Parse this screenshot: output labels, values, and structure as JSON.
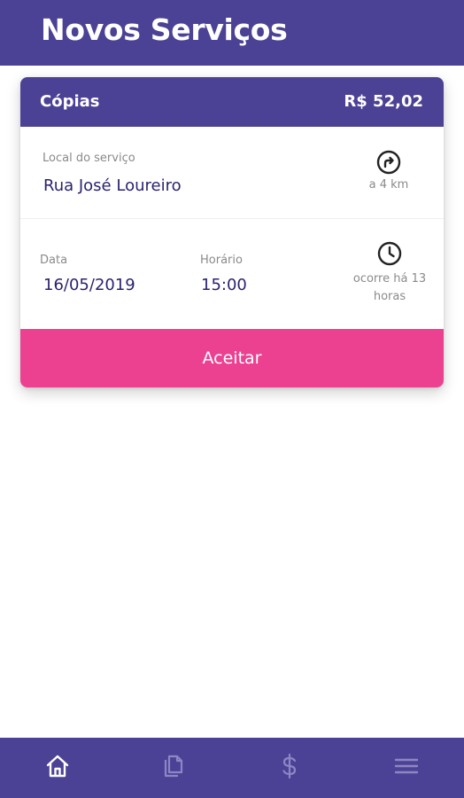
{
  "header": {
    "title": "Novos Serviços"
  },
  "card": {
    "service_name": "Cópias",
    "price": "R$  52,02",
    "location_label": "Local do serviço",
    "location_value": "Rua José Loureiro",
    "distance_text": "a 4 km",
    "date_label": "Data",
    "date_value": "16/05/2019",
    "time_label": "Horário",
    "time_value": "15:00",
    "elapsed_text": "ocorre há 13 horas",
    "accept_label": "Aceitar"
  },
  "bottom_nav": {
    "items": [
      {
        "icon": "home-icon",
        "active": true
      },
      {
        "icon": "documents-icon",
        "active": false
      },
      {
        "icon": "dollar-icon",
        "active": false
      },
      {
        "icon": "menu-icon",
        "active": false
      }
    ]
  },
  "colors": {
    "primary": "#4c4295",
    "accent": "#ec4191",
    "value_text": "#2a2370",
    "nav_active": "#ffffff",
    "nav_inactive": "#8d86c4"
  }
}
